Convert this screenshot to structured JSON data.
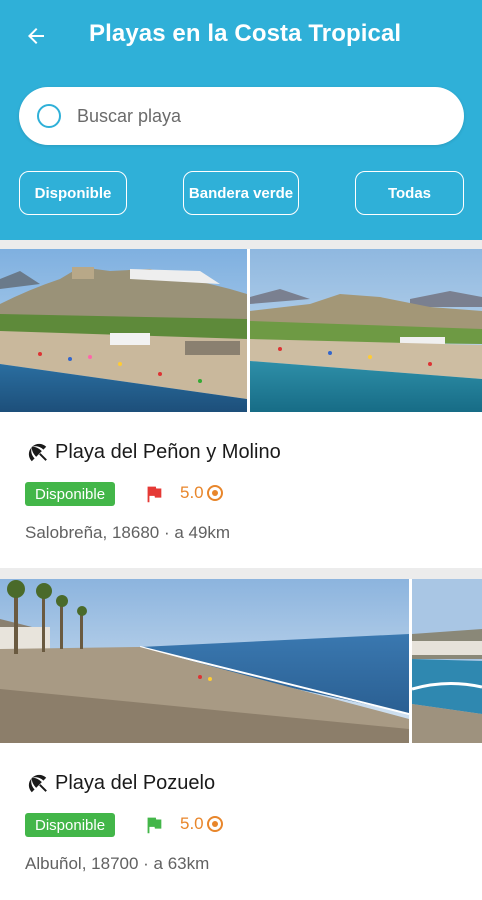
{
  "header": {
    "title": "Playas en la Costa Tropical",
    "back_icon": "arrow-left-icon",
    "background_color": "#2fb0d8"
  },
  "search": {
    "placeholder": "Buscar playa",
    "value": ""
  },
  "filters": [
    {
      "label": "Disponible"
    },
    {
      "label": "Bandera verde"
    },
    {
      "label": "Todas"
    }
  ],
  "beaches": [
    {
      "name": "Playa del Peñon y Molino",
      "status": "Disponible",
      "flag_color": "#e53935",
      "flag_icon": "red-flag-icon",
      "rating": "5.0",
      "location": "Salobreña, 18680 · a 49km"
    },
    {
      "name": "Playa del Pozuelo",
      "status": "Disponible",
      "flag_color": "#43b649",
      "flag_icon": "green-flag-icon",
      "rating": "5.0",
      "location": "Albuñol, 18700 · a 63km"
    }
  ],
  "colors": {
    "accent": "#2fb0d8",
    "status_badge": "#43b649",
    "rating": "#e8862b"
  }
}
